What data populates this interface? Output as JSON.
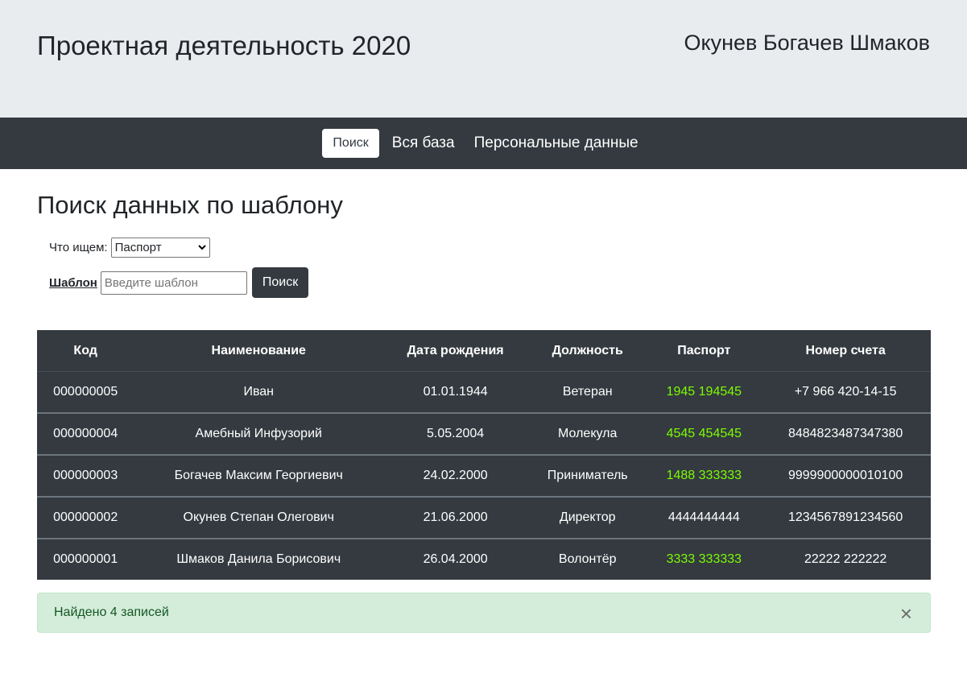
{
  "header": {
    "title": "Проектная деятельность 2020",
    "authors": "Окунев Богачев Шмаков"
  },
  "nav": {
    "items": [
      {
        "label": "Поиск",
        "active": true
      },
      {
        "label": "Вся база",
        "active": false
      },
      {
        "label": "Персональные данные",
        "active": false
      }
    ]
  },
  "main": {
    "heading": "Поиск данных по шаблону",
    "field_label": "Что ищем:",
    "field_select_value": "Паспорт",
    "template_label": "Шаблон",
    "template_placeholder": "Введите шаблон",
    "search_button": "Поиск"
  },
  "table": {
    "headers": [
      "Код",
      "Наименование",
      "Дата рождения",
      "Должность",
      "Паспорт",
      "Номер счета"
    ],
    "rows": [
      {
        "code": "000000005",
        "name": "Иван",
        "birth": "01.01.1944",
        "position": "Ветеран",
        "passport": "1945 194545",
        "account": "+7 966 420-14-15",
        "passport_highlight": true
      },
      {
        "code": "000000004",
        "name": "Амебный Инфузорий",
        "birth": "5.05.2004",
        "position": "Молекула",
        "passport": "4545 454545",
        "account": "8484823487347380",
        "passport_highlight": true
      },
      {
        "code": "000000003",
        "name": "Богачев Максим Георгиевич",
        "birth": "24.02.2000",
        "position": "Приниматель",
        "passport": "1488 333333",
        "account": "9999900000010100",
        "passport_highlight": true
      },
      {
        "code": "000000002",
        "name": "Окунев Степан Олегович",
        "birth": "21.06.2000",
        "position": "Директор",
        "passport": "4444444444",
        "account": "1234567891234560",
        "passport_highlight": false
      },
      {
        "code": "000000001",
        "name": "Шмаков Данила Борисович",
        "birth": "26.04.2000",
        "position": "Волонтёр",
        "passport": "3333 333333",
        "account": "22222 222222",
        "passport_highlight": true
      }
    ]
  },
  "alert": {
    "text": "Найдено 4 записей",
    "close": "×"
  },
  "colors": {
    "header_bg": "#e9ecef",
    "nav_bg": "#343a40",
    "table_bg": "#343a40",
    "highlight": "#7cfc00",
    "alert_bg": "#d4edda"
  }
}
